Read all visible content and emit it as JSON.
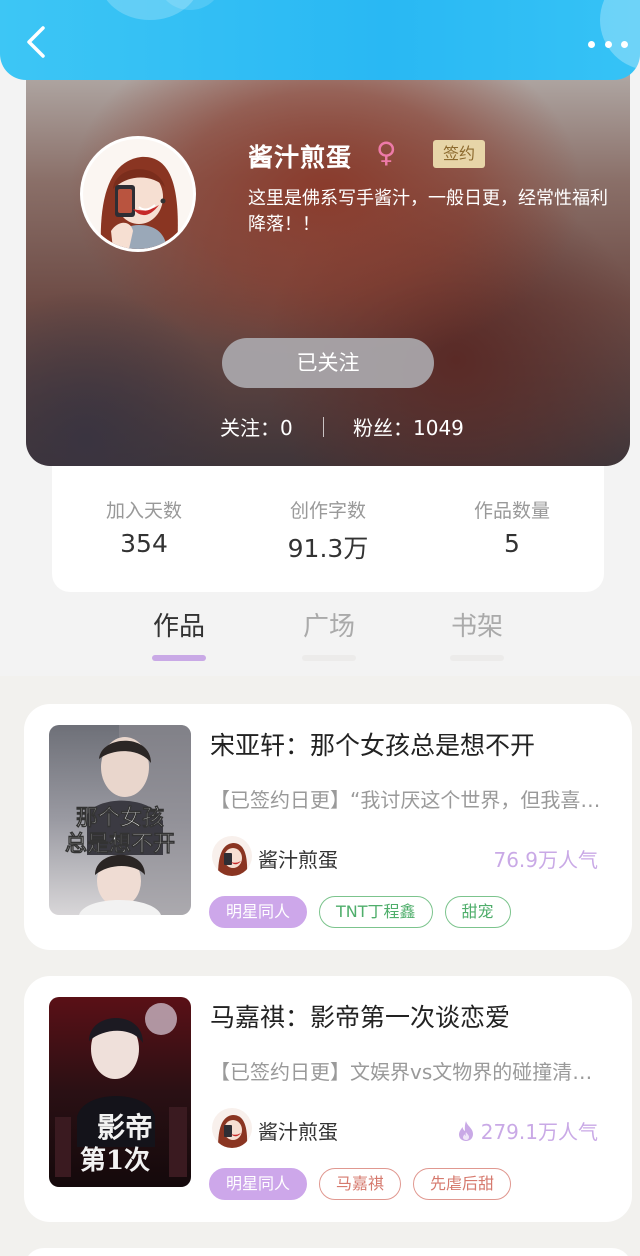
{
  "header": {
    "back_icon": "chevron-left-icon",
    "more_icon": "more-dots-icon"
  },
  "profile": {
    "nickname": "酱汁煎蛋",
    "gender_symbol": "♀",
    "badge": "签约",
    "bio": "这里是佛系写手酱汁，一般日更，经常性福利降落！！",
    "follow_button": "已关注",
    "following": "关注：0",
    "fans": "粉丝：1049"
  },
  "stats": [
    {
      "label": "加入天数",
      "value": "354"
    },
    {
      "label": "创作字数",
      "value": "91.3万"
    },
    {
      "label": "作品数量",
      "value": "5"
    }
  ],
  "tabs": [
    {
      "label": "作品",
      "active": true
    },
    {
      "label": "广场",
      "active": false
    },
    {
      "label": "书架",
      "active": false
    }
  ],
  "books": [
    {
      "title": "宋亚轩：那个女孩总是想不开",
      "intro": "【已签约日更】“我讨厌这个世界，但我喜…",
      "cover_text": [
        "那个女孩",
        "总是想不开"
      ],
      "author": "酱汁煎蛋",
      "popularity": "76.9万人气",
      "hot": false,
      "tags": [
        {
          "label": "明星同人",
          "style": "fill"
        },
        {
          "label": "TNT丁程鑫",
          "style": "green"
        },
        {
          "label": "甜宠",
          "style": "green"
        }
      ]
    },
    {
      "title": "马嘉祺：影帝第一次谈恋爱",
      "intro": "【已签约日更】文娱界vs文物界的碰撞清…",
      "cover_text": [
        "影帝",
        "第1次"
      ],
      "author": "酱汁煎蛋",
      "popularity": "279.1万人气",
      "hot": true,
      "tags": [
        {
          "label": "明星同人",
          "style": "fill"
        },
        {
          "label": "马嘉祺",
          "style": "red"
        },
        {
          "label": "先虐后甜",
          "style": "red"
        }
      ]
    }
  ],
  "colors": {
    "accent": "#c9a9e6",
    "header_blue": "#29b8f3",
    "badge_gold": "#e7d5a8"
  }
}
